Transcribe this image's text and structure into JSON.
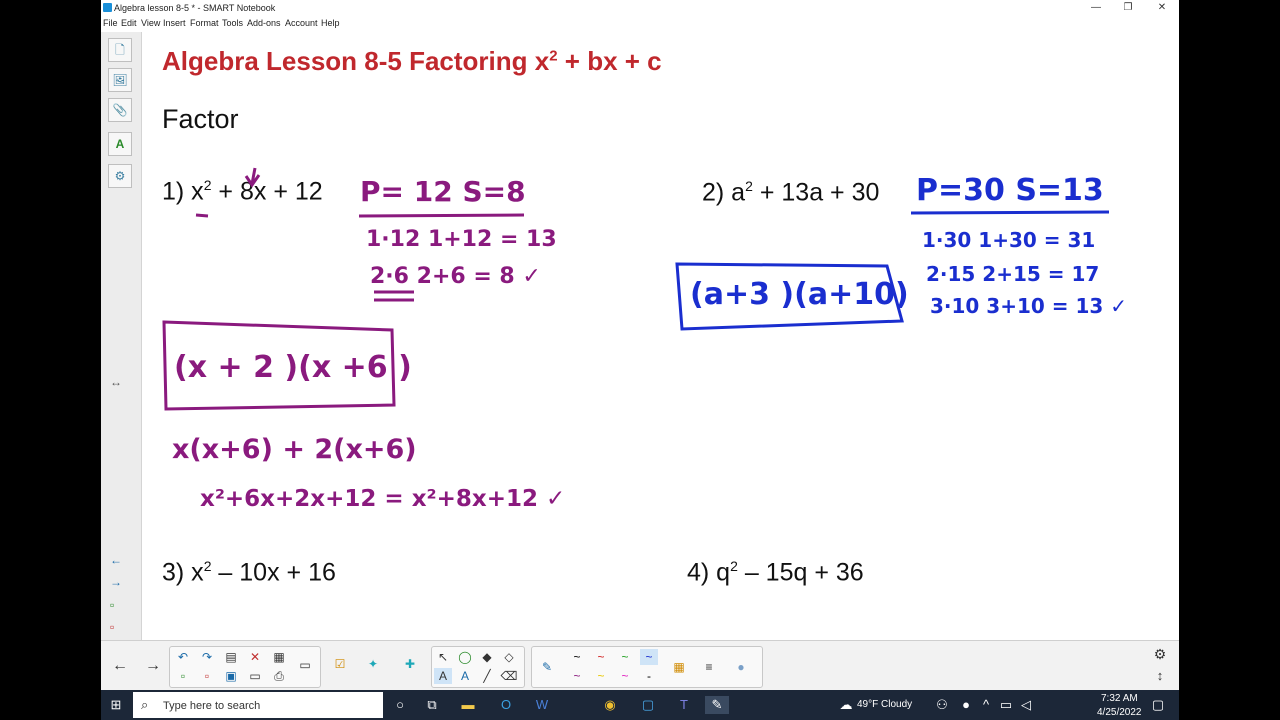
{
  "window": {
    "title": "Algebra lesson 8-5 * - SMART Notebook",
    "minimize": "—",
    "restore": "❐",
    "close": "✕"
  },
  "menu": [
    "File",
    "Edit",
    "View",
    "Insert",
    "Format",
    "Tools",
    "Add-ons",
    "Account",
    "Help"
  ],
  "sidebar": {
    "page_sorter": "🗋",
    "gallery": "🖼",
    "attachments": "📎",
    "properties": "A",
    "addons": "⚙",
    "resize_handle": "↔",
    "prev_page": "←",
    "next_page": "→"
  },
  "page": {
    "heading_text": "Algebra Lesson 8-5 Factoring x",
    "heading_exp": "2",
    "heading_rest": " + bx + c",
    "factor_label": "Factor",
    "p1_pre": "1) x",
    "p1_exp": "2",
    "p1_rest": " + 8x + 12",
    "p2_pre": "2) a",
    "p2_exp": "2",
    "p2_rest": " + 13a + 30",
    "p3_pre": "3)  x",
    "p3_exp": "2",
    "p3_rest": " – 10x + 16",
    "p4_pre": "4)  q",
    "p4_exp": "2",
    "p4_rest": " – 15q + 36"
  },
  "ink": {
    "p1_header": "P= 12   S=8",
    "p1_row1": "1·12      1+12 = 13",
    "p1_row2": "2·6       2+6 = 8 ✓",
    "p1_answer": "(x + 2 )(x +6 )",
    "p1_check1": "x(x+6) + 2(x+6)",
    "p1_check2": "x²+6x+2x+12 = x²+8x+12 ✓",
    "p2_header": "P=30  S=13",
    "p2_row1": "1·30     1+30 = 31",
    "p2_row2": "2·15     2+15 = 17",
    "p2_row3": "3·10     3+10 = 13 ✓",
    "p2_answer": "(a+3 )(a+10)",
    "colors": {
      "purple": "#8a1a7e",
      "blue": "#1a2ecf",
      "heading": "#c0282d"
    }
  },
  "toolbar": {
    "back": "←",
    "forward": "→",
    "undo": "↶",
    "redo": "↷",
    "delete": "✕",
    "table": "▦",
    "select": "↖",
    "pen": "✎",
    "eraser": "⌫",
    "gear": "⚙",
    "expand": "↕"
  },
  "taskbar": {
    "search_placeholder": "Type here to search",
    "weather": "49°F  Cloudy",
    "time": "7:32 AM",
    "date": "4/25/2022"
  }
}
